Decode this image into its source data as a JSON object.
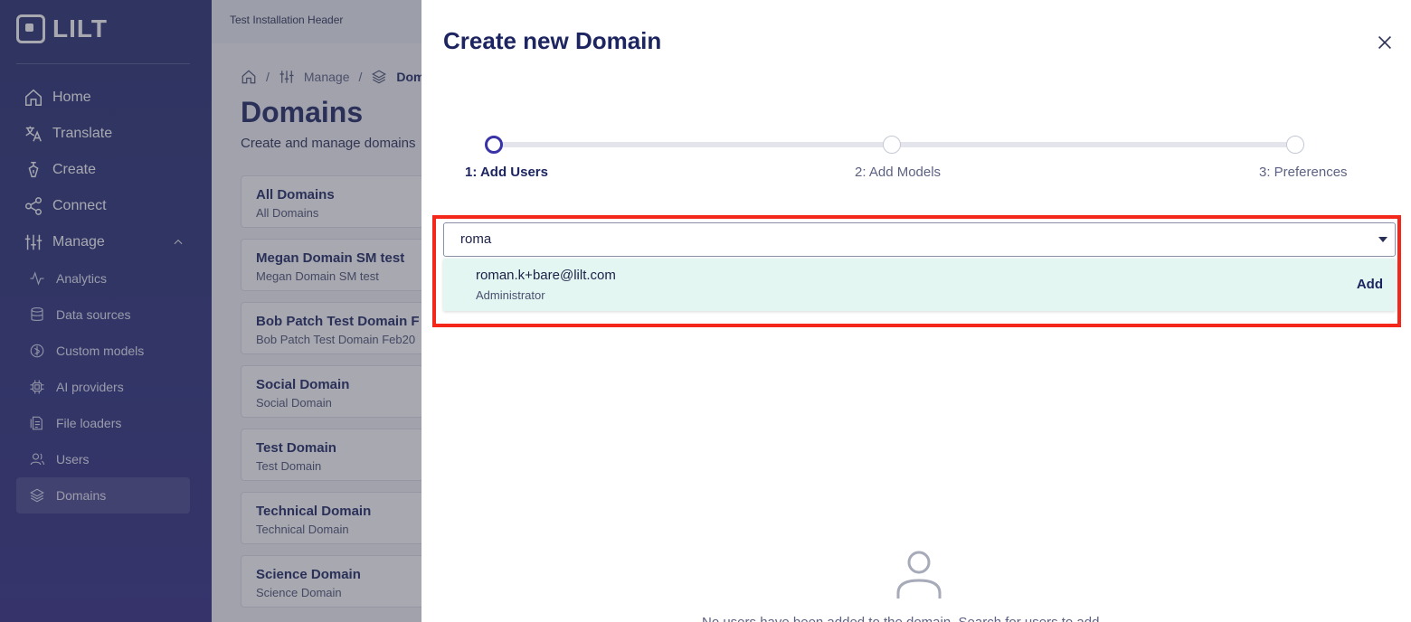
{
  "brand": {
    "logo_text": "LILT"
  },
  "sidebar": {
    "items": [
      {
        "label": "Home",
        "icon": "home-icon"
      },
      {
        "label": "Translate",
        "icon": "translate-icon"
      },
      {
        "label": "Create",
        "icon": "pen-icon"
      },
      {
        "label": "Connect",
        "icon": "share-icon"
      },
      {
        "label": "Manage",
        "icon": "sliders-icon",
        "expanded": true
      }
    ],
    "subitems": [
      {
        "label": "Analytics",
        "icon": "activity-icon"
      },
      {
        "label": "Data sources",
        "icon": "database-icon"
      },
      {
        "label": "Custom models",
        "icon": "custom-models-icon"
      },
      {
        "label": "AI providers",
        "icon": "chip-icon"
      },
      {
        "label": "File loaders",
        "icon": "file-loader-icon"
      },
      {
        "label": "Users",
        "icon": "users-icon"
      },
      {
        "label": "Domains",
        "icon": "layers-icon",
        "active": true
      }
    ]
  },
  "main": {
    "install_header": "Test Installation Header",
    "breadcrumb": {
      "manage": "Manage",
      "current": "Dom"
    },
    "title": "Domains",
    "subtitle": "Create and manage domains",
    "domains": [
      {
        "name": "All Domains",
        "sub": "All Domains"
      },
      {
        "name": "Megan Domain SM test",
        "sub": "Megan Domain SM test"
      },
      {
        "name": "Bob Patch Test Domain F",
        "sub": "Bob Patch Test Domain Feb20"
      },
      {
        "name": "Social Domain",
        "sub": "Social Domain"
      },
      {
        "name": "Test Domain",
        "sub": "Test Domain"
      },
      {
        "name": "Technical Domain",
        "sub": "Technical Domain"
      },
      {
        "name": "Science Domain",
        "sub": "Science Domain"
      }
    ]
  },
  "drawer": {
    "title": "Create new Domain",
    "steps": [
      {
        "label": "1: Add Users",
        "active": true
      },
      {
        "label": "2: Add Models",
        "active": false
      },
      {
        "label": "3: Preferences",
        "active": false
      }
    ],
    "search": {
      "value": "roma"
    },
    "option": {
      "email": "roman.k+bare@lilt.com",
      "role": "Administrator",
      "action": "Add"
    },
    "empty_text": "No users have been added to the domain. Search for users to add."
  },
  "colors": {
    "accent": "#3a33a8",
    "highlight": "#f3271a",
    "option_bg": "#e3f6f2"
  }
}
